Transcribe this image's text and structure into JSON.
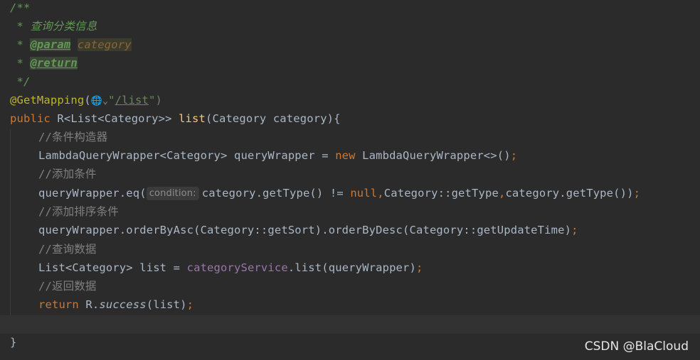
{
  "doc": {
    "open": "/**",
    "star": " * ",
    "summary": "查询分类信息",
    "param_tag": "@param",
    "param_name": "category",
    "return_tag": "@return",
    "close": " */"
  },
  "annotation": {
    "name": "@GetMapping",
    "open_paren": "(",
    "globe_icon": "🌐",
    "chevron": "⌄",
    "quote": "\"",
    "path": "/list",
    "close": "\")"
  },
  "signature": {
    "modifier": "public",
    "return_type": " R<List<Category>> ",
    "method": "list",
    "params": "(Category category){"
  },
  "body": {
    "c1": "//条件构造器",
    "l1_a": "LambdaQueryWrapper<Category> queryWrapper = ",
    "l1_new": "new",
    "l1_b": " LambdaQueryWrapper<>()",
    "semi": ";",
    "c2": "//添加条件",
    "l2_a": "queryWrapper.eq(",
    "l2_hint": "condition:",
    "l2_b": "category.getType() != ",
    "l2_null": "null",
    "comma": ",",
    "l2_c": "Category::getType",
    "l2_d": "category.getType())",
    "c3": "//添加排序条件",
    "l3": "queryWrapper.orderByAsc(Category::getSort).orderByDesc(Category::getUpdateTime)",
    "c4": "//查询数据",
    "l4_a": "List<Category> list = ",
    "l4_field": "categoryService",
    "l4_b": ".list(queryWrapper)",
    "c5": "//返回数据",
    "l5_kw": "return",
    "l5_a": " R.",
    "l5_method": "success",
    "l5_b": "(list)",
    "close": "}"
  },
  "watermark": "CSDN @BlaCloud",
  "colors": {
    "background": "#2b2b2b",
    "keyword": "#cc7832",
    "method": "#ffc66d",
    "string": "#6a8759",
    "comment": "#808080",
    "doc": "#629755",
    "annotation": "#bbb529",
    "field": "#9876aa"
  }
}
